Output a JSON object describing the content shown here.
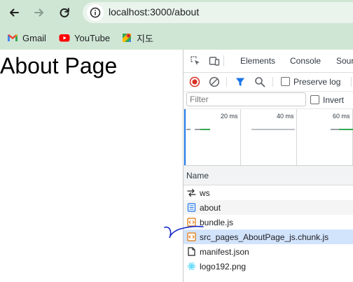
{
  "browser": {
    "url": "localhost:3000/about",
    "bookmarks": [
      {
        "label": "Gmail",
        "icon": "gmail-icon"
      },
      {
        "label": "YouTube",
        "icon": "youtube-icon"
      },
      {
        "label": "지도",
        "icon": "maps-icon"
      }
    ],
    "chrome_color": "#cfe6d4"
  },
  "page": {
    "title": "About Page"
  },
  "devtools": {
    "tabs": [
      "Elements",
      "Console",
      "Sour"
    ],
    "toolbar": {
      "preserve_log_label": "Preserve log",
      "preserve_log_checked": false
    },
    "filter": {
      "placeholder": "Filter",
      "value": "",
      "invert_label": "Invert",
      "invert_checked": false
    },
    "overview_ticks": [
      "20 ms",
      "40 ms",
      "60 ms"
    ],
    "column_header": "Name",
    "requests": [
      {
        "name": "ws",
        "icon": "websocket-icon"
      },
      {
        "name": "about",
        "icon": "document-icon"
      },
      {
        "name": "bundle.js",
        "icon": "script-icon"
      },
      {
        "name": "src_pages_AboutPage_js.chunk.js",
        "icon": "script-icon",
        "selected": true
      },
      {
        "name": "manifest.json",
        "icon": "manifest-icon"
      },
      {
        "name": "logo192.png",
        "icon": "image-icon"
      }
    ],
    "colors": {
      "record": "#d93025",
      "filter_accent": "#1a73e8",
      "selected_row": "#d2e3fc"
    }
  }
}
